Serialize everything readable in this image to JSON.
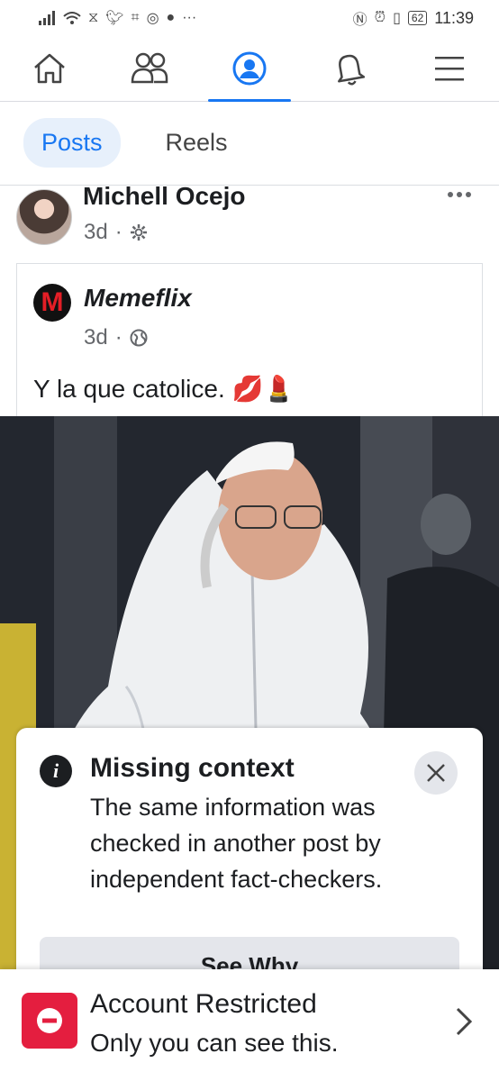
{
  "status_bar": {
    "time": "11:39",
    "battery": "62",
    "left_icons": [
      "signal-icon",
      "wifi-icon",
      "hourglass-icon",
      "twitter-icon",
      "vpn-icon",
      "instagram-icon",
      "chat-icon",
      "more-icon"
    ],
    "right_icons": [
      "nfc-icon",
      "alarm-icon",
      "vibrate-icon",
      "battery-icon"
    ]
  },
  "nav": {
    "items": [
      "home",
      "friends",
      "profile",
      "notifications",
      "menu"
    ],
    "active": "profile"
  },
  "tabs": [
    {
      "label": "Posts",
      "active": true
    },
    {
      "label": "Reels",
      "active": false
    }
  ],
  "post": {
    "author": "Michell Ocejo",
    "time": "3d",
    "privacy_icon": "gear-icon",
    "shared": {
      "page_logo": "M",
      "page_name": "Memeflix",
      "time": "3d",
      "privacy_icon": "globe-icon",
      "text": "Y la que catolice. 💋💄"
    }
  },
  "overlay": {
    "title": "Missing context",
    "body": "The same information was checked in another post by independent fact-checkers.",
    "button": "See Why"
  },
  "restricted": {
    "title": "Account Restricted",
    "subtitle": "Only you can see this."
  },
  "colors": {
    "accent": "#1877f2",
    "restricted_red": "#e41e3f"
  }
}
